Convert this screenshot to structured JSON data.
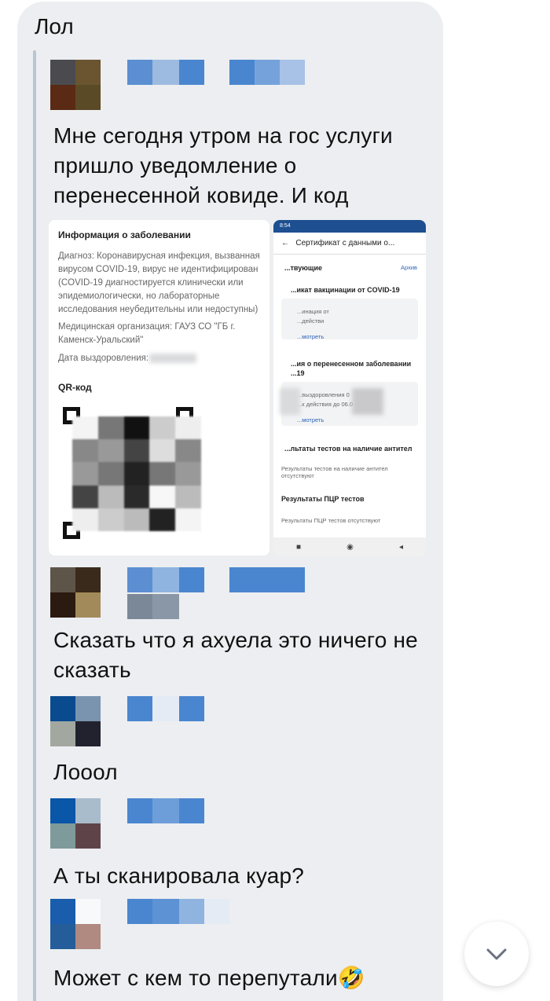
{
  "chat": {
    "bubble_title": "Лол",
    "messages": [
      {
        "text": "Мне сегодня утром на гос услуги пришло уведомление о перенесенной ковиде. И код"
      },
      {
        "text": "Сказать что я ахуела это ничего не сказать"
      },
      {
        "text": "Лооол"
      },
      {
        "text": "А ты сканировала куар?"
      },
      {
        "text": "Может с кем то перепутали🤣"
      }
    ]
  },
  "screenshot1": {
    "heading": "Информация о заболевании",
    "diagnosis": "Диагноз: Коронавирусная инфекция, вызванная вирусом COVID-19, вирус не идентифицирован (COVID-19 диагностируется клинически или эпидемиологически, но лабораторные исследования неубедительны или недоступны)",
    "organization": "Медицинская организация: ГАУЗ СО \"ГБ г. Каменск-Уральский\"",
    "recovery_date": "Дата выздоровления:",
    "qr_label": "QR-код"
  },
  "screenshot2": {
    "status_time": "8:54",
    "header_title": "Сертификат с данными о...",
    "back_icon": "arrow-left-icon",
    "section_active": "...твующие",
    "archive_link": "Архив",
    "vacc_title": "...икат вакцинации от COVID-19",
    "vacc_line1": "...инация от",
    "vacc_line2": "...действи",
    "vacc_link": "...мотреть",
    "ill_title": "...ия о перенесенном заболевании",
    "ill_title2": "...19",
    "ill_line1": "...выздоровления 0",
    "ill_line2": "...к действия до 06.0",
    "ill_link": "...мотреть",
    "antibody_title": "...льтаты тестов на наличие антител",
    "antibody_text": "Результаты тестов на наличие антител отсутствуют",
    "pcr_title": "Результаты ПЦР тестов",
    "pcr_text": "Результаты ПЦР тестов отсутствуют",
    "nav_square": "■",
    "nav_circle": "◉",
    "nav_back": "◂"
  },
  "colors": {
    "bubble": "#eceef1",
    "accent_blue": "#4a86cf"
  },
  "scroll_icon": "chevron-down-icon"
}
